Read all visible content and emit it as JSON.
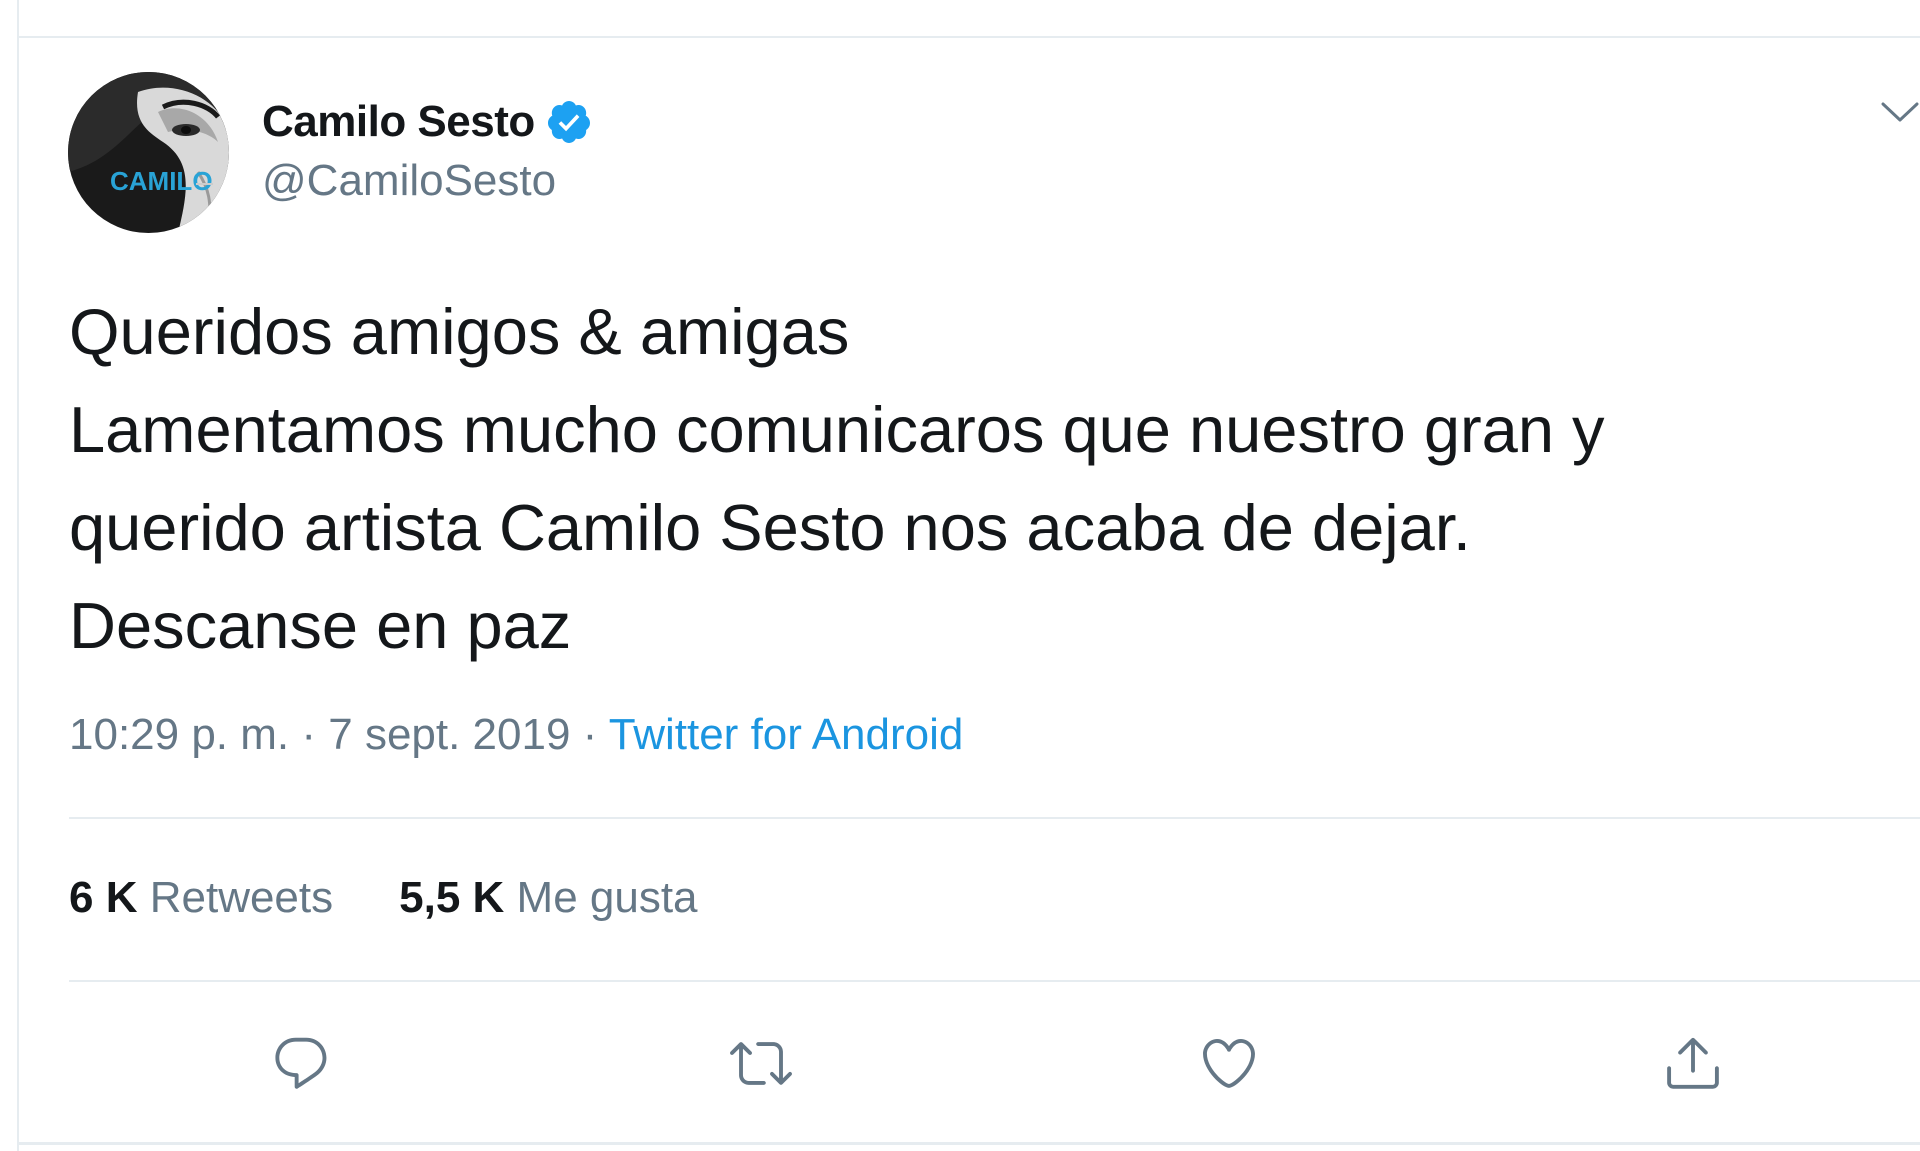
{
  "user": {
    "display_name": "Camilo Sesto",
    "handle": "@CamiloSesto",
    "avatar_text": "CAMILO",
    "verified": true
  },
  "tweet": {
    "lines": [
      "Queridos amigos & amigas",
      "Lamentamos mucho comunicaros que nuestro gran y",
      "querido artista Camilo Sesto nos acaba de dejar.",
      "Descanse en paz"
    ],
    "time": "10:29 p. m.",
    "separator": " · ",
    "date": "7 sept. 2019",
    "source": "Twitter for Android"
  },
  "stats": {
    "retweets_count": "6 K",
    "retweets_label": "Retweets",
    "likes_count": "5,5 K",
    "likes_label": "Me gusta"
  },
  "actions": [
    "reply-icon",
    "retweet-icon",
    "like-icon",
    "share-icon"
  ],
  "colors": {
    "text": "#14171a",
    "secondary": "#657786",
    "link": "#1b95e0",
    "verified": "#1da1f2",
    "border": "#e6ecf0"
  }
}
